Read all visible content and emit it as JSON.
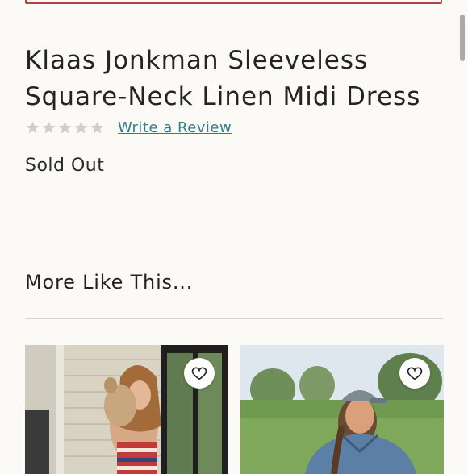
{
  "product": {
    "title_line1": "Klaas Jonkman Sleeveless",
    "title_line2": "Square-Neck Linen Midi Dress",
    "rating_stars": 0,
    "review_link": "Write a Review",
    "status": "Sold Out"
  },
  "recommendations": {
    "heading": "More Like This...",
    "items": [
      {
        "image": "woman-holding-dog-photo",
        "icon": "heart-icon"
      },
      {
        "image": "woman-in-cap-field-photo",
        "icon": "heart-icon"
      }
    ]
  },
  "colors": {
    "background": "#fbfaf6",
    "link": "#2f7f8c",
    "star_empty": "#cfcfcf",
    "top_border": "#b0473f"
  }
}
